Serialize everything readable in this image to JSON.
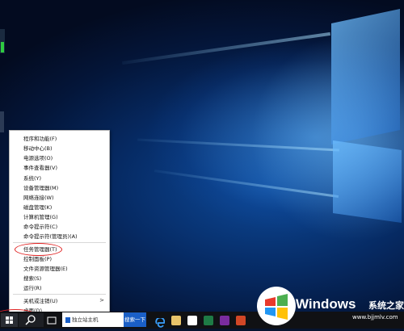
{
  "context_menu": {
    "items": [
      {
        "label": "程序和功能(F)"
      },
      {
        "label": "移动中心(B)"
      },
      {
        "label": "电源选项(O)"
      },
      {
        "label": "事件查看器(V)"
      },
      {
        "label": "系统(Y)"
      },
      {
        "label": "设备管理器(M)"
      },
      {
        "label": "网络连接(W)"
      },
      {
        "label": "磁盘管理(K)"
      },
      {
        "label": "计算机管理(G)"
      },
      {
        "label": "命令提示符(C)"
      },
      {
        "label": "命令提示符(管理员)(A)"
      },
      {
        "label": "任务管理器(T)"
      },
      {
        "label": "控制面板(P)"
      },
      {
        "label": "文件资源管理器(E)"
      },
      {
        "label": "搜索(S)"
      },
      {
        "label": "运行(R)"
      },
      {
        "label": "关机或注销(U)",
        "submenu_arrow": ">"
      },
      {
        "label": "桌面(D)"
      }
    ],
    "highlight_color": "#e02020"
  },
  "taskbar": {
    "search_text": "独立站主机",
    "search_button": "搜索一下"
  },
  "watermark": {
    "brand": "Windows",
    "brand_cn": "系统之家",
    "url": "www.bjjmlv.com"
  }
}
